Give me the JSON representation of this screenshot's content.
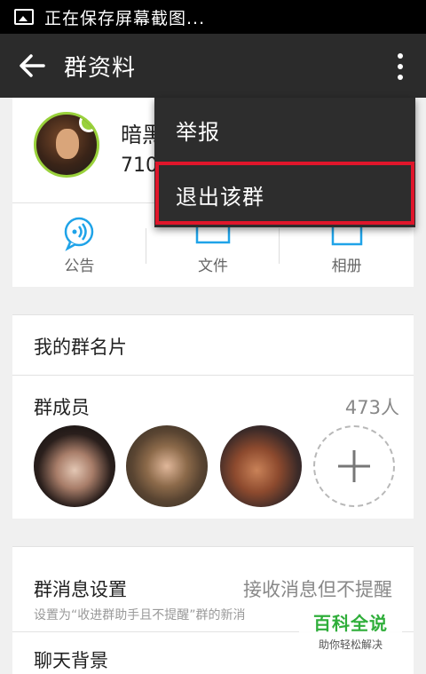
{
  "status_bar": {
    "notification_text": "正在保存屏幕截图..."
  },
  "app_bar": {
    "title": "群资料",
    "back_icon": "arrow-left-icon",
    "more_icon": "overflow-menu-icon"
  },
  "group": {
    "name_partial": "暗黑",
    "id_partial": "710"
  },
  "functions": [
    {
      "label": "公告",
      "icon": "announcement-icon",
      "color": "#1fa3e8"
    },
    {
      "label": "文件",
      "icon": "folder-icon",
      "color": "#1fa3e8"
    },
    {
      "label": "相册",
      "icon": "album-icon",
      "color": "#1fa3e8"
    }
  ],
  "my_card": {
    "label": "我的群名片"
  },
  "members": {
    "label": "群成员",
    "count": "473人",
    "add_icon": "plus-icon"
  },
  "message_settings": {
    "label": "群消息设置",
    "value": "接收消息但不提醒",
    "description": "设置为“收进群助手且不提醒”群的新消"
  },
  "chat_background": {
    "label": "聊天背景"
  },
  "menu": {
    "items": [
      {
        "label": "举报"
      },
      {
        "label": "退出该群"
      }
    ],
    "highlight_color": "#e0162b"
  },
  "watermark": {
    "title": "百科全说",
    "subtitle": "助你轻松解决"
  }
}
